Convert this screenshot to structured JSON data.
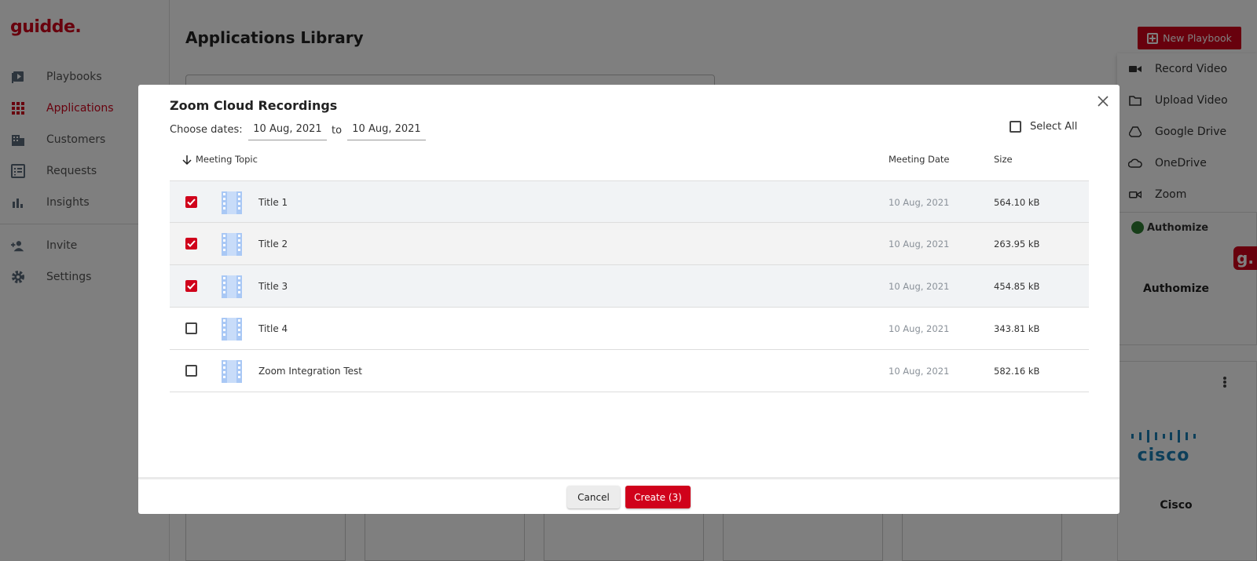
{
  "app": {
    "logo": "guidde."
  },
  "sidebar": {
    "items": [
      {
        "label": "Playbooks",
        "icon": "playbooks-icon"
      },
      {
        "label": "Applications",
        "icon": "apps-grid-icon",
        "active": true
      },
      {
        "label": "Customers",
        "icon": "building-icon"
      },
      {
        "label": "Requests",
        "icon": "list-icon"
      },
      {
        "label": "Insights",
        "icon": "bar-chart-icon"
      }
    ],
    "bottom_items": [
      {
        "label": "Invite",
        "icon": "add-user-icon"
      },
      {
        "label": "Settings",
        "icon": "gear-icon"
      }
    ]
  },
  "main": {
    "title": "Applications Library",
    "new_playbook_label": "New Playbook",
    "dropdown": [
      {
        "label": "Record Video",
        "icon": "video-camera-icon"
      },
      {
        "label": "Upload Video",
        "icon": "folder-icon"
      },
      {
        "label": "Google Drive",
        "icon": "google-drive-icon"
      },
      {
        "label": "OneDrive",
        "icon": "cloud-icon"
      },
      {
        "label": "Zoom",
        "icon": "zoom-camera-icon"
      }
    ],
    "cards": [
      {
        "logo_text": "Authomize",
        "name": "Authomize"
      },
      {
        "logo_text": "cisco",
        "name": "Cisco"
      }
    ],
    "badge": "g."
  },
  "modal": {
    "title": "Zoom Cloud Recordings",
    "choose_dates_label": "Choose dates:",
    "date_from": "10 Aug, 2021",
    "to_label": "to",
    "date_to": "10 Aug, 2021",
    "select_all_label": "Select All",
    "columns": {
      "topic": "Meeting Topic",
      "date": "Meeting Date",
      "size": "Size"
    },
    "rows": [
      {
        "topic": "Title 1",
        "date": "10 Aug, 2021",
        "size": "564.10 kB",
        "checked": true
      },
      {
        "topic": "Title 2",
        "date": "10 Aug, 2021",
        "size": "263.95 kB",
        "checked": true
      },
      {
        "topic": "Title 3",
        "date": "10 Aug, 2021",
        "size": "454.85 kB",
        "checked": true
      },
      {
        "topic": "Title 4",
        "date": "10 Aug, 2021",
        "size": "343.81 kB",
        "checked": false
      },
      {
        "topic": "Zoom Integration Test",
        "date": "10 Aug, 2021",
        "size": "582.16 kB",
        "checked": false
      }
    ],
    "cancel_label": "Cancel",
    "create_label": "Create (3)"
  },
  "colors": {
    "accent": "#d0021b",
    "film_icon": "#a9c8f5",
    "overlay": "#000000"
  }
}
